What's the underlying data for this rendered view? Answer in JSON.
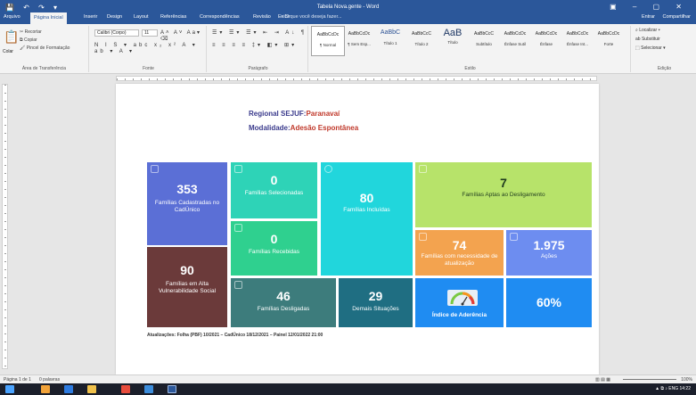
{
  "window": {
    "title": "Tabela Nova.gente - Word",
    "quick_access": "💾 ↶ ↷ ▾",
    "controls": "▣ – ▢ ✕"
  },
  "ribbon_tabs": [
    {
      "label": "Arquivo",
      "active": false
    },
    {
      "label": "Página Inicial",
      "active": true
    },
    {
      "label": "Inserir",
      "active": false
    },
    {
      "label": "Design",
      "active": false
    },
    {
      "label": "Layout",
      "active": false
    },
    {
      "label": "Referências",
      "active": false
    },
    {
      "label": "Correspondências",
      "active": false
    },
    {
      "label": "Revisão",
      "active": false
    },
    {
      "label": "Exibir",
      "active": false
    }
  ],
  "tell_me": "♀ O que você deseja fazer...",
  "sign_in": "Entrar",
  "share": "Compartilhar",
  "clipboard": {
    "paste": "Colar",
    "cut": "Recortar",
    "copy": "Copiar",
    "format_painter": "Pincel de Formatação",
    "group": "Área de Transferência"
  },
  "font": {
    "name": "Calibri (Corpo)",
    "size": "11",
    "group": "Fonte",
    "glyphs_row1": "A˄ A˅ Aa▾ ⌫",
    "glyphs_row2": "N I S ▾ abc x₂ x² A ▾ ab ▾ A ▾"
  },
  "paragraph": {
    "group": "Parágrafo",
    "glyphs_row1": "☰▾ ☰▾ ☰▾ ⇤ ⇥ A↓ ¶",
    "glyphs_row2": "≡ ≡ ≡ ≡ ‡▾ ◧▾ ⊞▾"
  },
  "styles": {
    "group": "Estilo",
    "items": [
      {
        "preview": "AaBbCcDc",
        "name": "¶ Normal",
        "selected": true,
        "size": "small"
      },
      {
        "preview": "AaBbCcDc",
        "name": "¶ Sem Esp...",
        "selected": false,
        "size": "small"
      },
      {
        "preview": "AaBbC",
        "name": "Título 1",
        "selected": false,
        "size": "mid"
      },
      {
        "preview": "AaBbCcC",
        "name": "Título 2",
        "selected": false,
        "size": "small"
      },
      {
        "preview": "AaB",
        "name": "Título",
        "selected": false,
        "size": "big"
      },
      {
        "preview": "AaBbCcC",
        "name": "Subtítulo",
        "selected": false,
        "size": "small"
      },
      {
        "preview": "AaBbCcDc",
        "name": "Ênfase Sutil",
        "selected": false,
        "size": "small"
      },
      {
        "preview": "AaBbCcDc",
        "name": "Ênfase",
        "selected": false,
        "size": "small"
      },
      {
        "preview": "AaBbCcDc",
        "name": "Ênfase Int...",
        "selected": false,
        "size": "small"
      },
      {
        "preview": "AaBbCcDc",
        "name": "Forte",
        "selected": false,
        "size": "small"
      }
    ]
  },
  "editing": {
    "find": "⌕ Localizar ▾",
    "replace": "ab Substituir",
    "select": "⬚ Selecionar ▾",
    "group": "Edição"
  },
  "document": {
    "line1_label": "Regional SEJUF:",
    "line1_value": "Paranavaí",
    "line2_label": "Modalidade:",
    "line2_value": "Adesão Espontânea",
    "footnote": "Atualizações: Folha (PBF) 10/2021 – CadÚnico 18/12/2021 – Painel 12/01/2022 21:00"
  },
  "tiles": {
    "cadastradas": {
      "value": "353",
      "label": "Famílias Cadastradas no CadÚnico",
      "color": "#5b6fd6"
    },
    "alta_vulnerabilidade": {
      "value": "90",
      "label": "Famílias em Alta Vulnerabilidade Social",
      "color": "#6b3a3a"
    },
    "selecionadas": {
      "value": "0",
      "label": "Famílias Selecionadas",
      "color": "#2ed3b7"
    },
    "recebidas": {
      "value": "0",
      "label": "Famílias Recebidas",
      "color": "#2fd08f"
    },
    "incluidas": {
      "value": "80",
      "label": "Famílias Incluídas",
      "color": "#21d6dc"
    },
    "aptas_desligamento": {
      "value": "7",
      "label": "Famílias Aptas ao Desligamento",
      "color": "#b7e36a"
    },
    "necessidade_atualizacao": {
      "value": "74",
      "label": "Famílias com necessidade de atualização",
      "color": "#f3a34f"
    },
    "acoes": {
      "value": "1.975",
      "label": "Ações",
      "color": "#6d8df0"
    },
    "desligadas": {
      "value": "46",
      "label": "Famílias Desligadas",
      "color": "#3d7c7c"
    },
    "demais": {
      "value": "29",
      "label": "Demais Situações",
      "color": "#1f6e82"
    },
    "aderencia": {
      "label": "Índice de Aderência",
      "color": "#1f8cf2"
    },
    "aderencia_pct": {
      "value": "60%",
      "color": "#1f8cf2"
    }
  },
  "status": {
    "page": "Página 1 de 1",
    "words": "0 palavras",
    "zoom": "100%",
    "view_icons": "▥ ▤ ▦"
  },
  "taskbar": {
    "clock": "14:22",
    "tray": "▲ ⧉ ♪ ENG"
  }
}
